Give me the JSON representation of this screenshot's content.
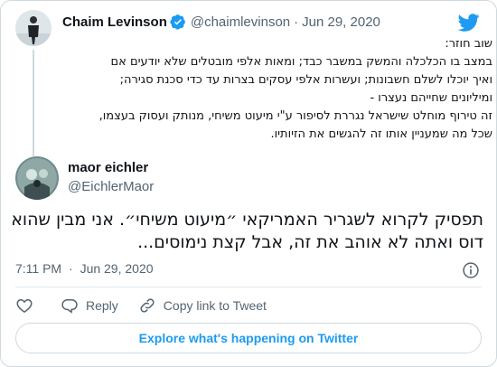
{
  "parent_tweet": {
    "display_name": "Chaim Levinson",
    "handle": "@chaimlevinson",
    "separator": "·",
    "date": "Jun 29, 2020",
    "lines": [
      "שוב חוזר:",
      "במצב בו הכלכלה והמשק במשבר כבד; ומאות אלפי מובטלים שלא יודעים אם",
      "ואיך יוכלו לשלם חשבונות; ועשרות אלפי עסקים בצרות עד כדי סכנת סגירה;",
      "ומיליונים שחייהם נעצרו -",
      "זה טירוף מוחלט שישראל נגררת לסיפור ע\"י מיעוט משיחי, מנותק ועסוק בעצמו,",
      "שכל מה שמעניין אותו זה להגשים את הזיותיו."
    ]
  },
  "main_tweet": {
    "display_name": "maor eichler",
    "handle": "@EichlerMaor",
    "lines": [
      "תפסיק לקרוא לשגריר האמריקאי ״מיעוט משיחי״. אני מבין שהוא",
      "דוס ואתה לא אוהב את זה, אבל קצת נימוסים..."
    ],
    "time": "7:11 PM",
    "separator": "·",
    "date": "Jun 29, 2020"
  },
  "actions": {
    "reply_label": "Reply",
    "copy_link_label": "Copy link to Tweet"
  },
  "explore_label": "Explore what's happening on Twitter",
  "colors": {
    "brand_blue": "#1d9bf0",
    "verified_blue": "#1d9bf0",
    "muted_text": "#536471",
    "border": "#cfd9de"
  },
  "icons": [
    "verified-badge-icon",
    "twitter-bird-icon",
    "info-icon",
    "heart-icon",
    "reply-icon",
    "link-icon"
  ]
}
